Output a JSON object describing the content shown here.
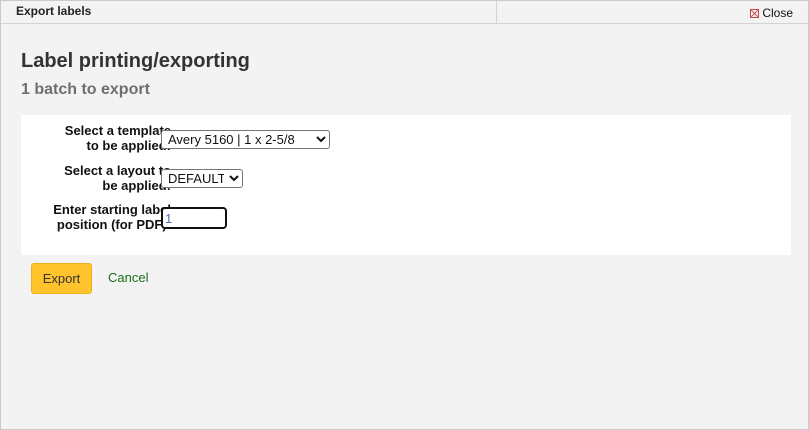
{
  "dialog": {
    "title": "Export labels",
    "close_label": "Close",
    "close_icon": "close-icon"
  },
  "page": {
    "heading": "Label printing/exporting",
    "subheading": "1 batch to export"
  },
  "form": {
    "template_label_line1": "Select a template",
    "template_label_line2": "to be applied:",
    "template_value": "Avery 5160 | 1 x 2-5/8",
    "layout_label_line1": "Select a layout to",
    "layout_label_line2": "be applied:",
    "layout_value": "DEFAULT",
    "position_label_line1": "Enter starting label",
    "position_label_line2": "position (for PDF):",
    "position_value": "1"
  },
  "actions": {
    "export_label": "Export",
    "cancel_label": "Cancel"
  },
  "colors": {
    "export_button": "#ffc32b",
    "cancel_link": "#1b6e1b"
  }
}
